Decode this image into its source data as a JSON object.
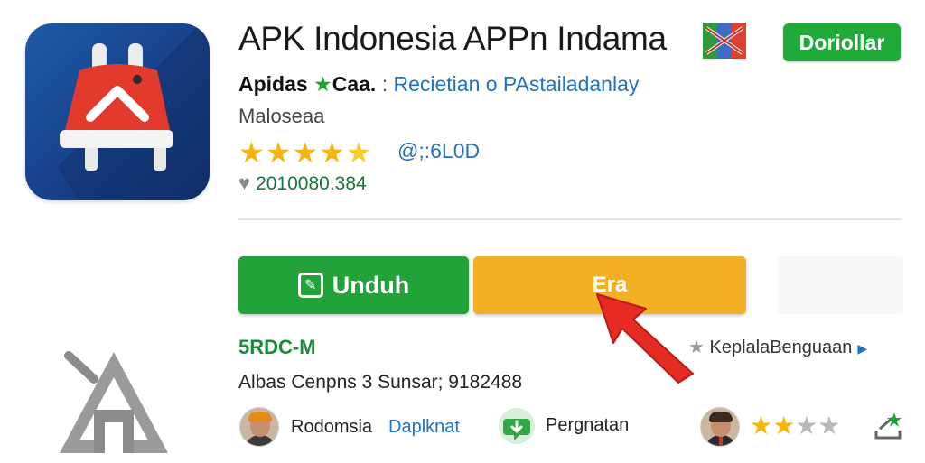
{
  "app": {
    "title": "APK Indonesia APPn Indama",
    "top_button_label": "Doriollar",
    "developer": "Apidas",
    "developer_suffix": "Caa.",
    "separator": ":",
    "category": "Recietian o PAstailadanlay",
    "maker": "Maloseaa",
    "rating_text": "@;:6L0D",
    "stars": 5,
    "size_text": "2010080.384"
  },
  "actions": {
    "install_label": "Unduh",
    "secondary_label": "Era"
  },
  "info": {
    "version": "5RDC-M",
    "language": "KeplalaBenguaan",
    "age_text": "Albas Cenpns 3 Sunsar; 9182488"
  },
  "reviews": {
    "reviewer_name": "Rodomsia",
    "reviewer_link": "Daplknat",
    "chat_label": "Pergnatan",
    "rating": 2,
    "rating_max": 4
  },
  "colors": {
    "install_green": "#21a33a",
    "secondary_orange": "#f3b024",
    "link_blue": "#1e73c4",
    "icon_blue": "#1e5aa8",
    "icon_red": "#e23b2e"
  },
  "icons": [
    "app-icon",
    "flag-icon",
    "star-icon",
    "heart-icon",
    "install-icon",
    "cursor-arrow-icon",
    "avatar",
    "chat-icon",
    "share-icon",
    "logo-a-icon"
  ]
}
